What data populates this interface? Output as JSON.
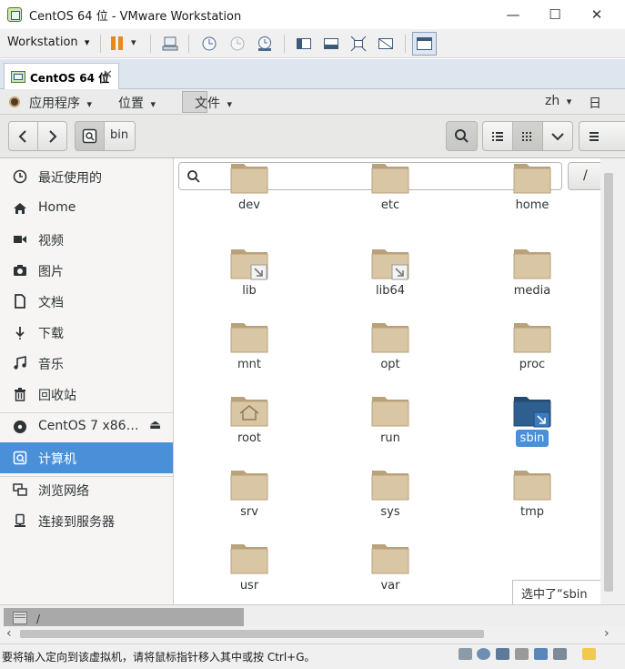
{
  "window": {
    "title": "CentOS 64 位 - VMware Workstation",
    "minimize": "—",
    "maximize": "☐",
    "close": "✕"
  },
  "vmware_toolbar": {
    "menu_label": "Workstation",
    "menu_arrow": "▾",
    "pause_arrow": "▾"
  },
  "tabs": [
    {
      "label": "CentOS 64 位",
      "close": "✕"
    }
  ],
  "gnome_topbar": {
    "applications": "应用程序",
    "places": "位置",
    "files": "文件",
    "language": "zh",
    "clock_partial": "日",
    "menu_arrow": "▾"
  },
  "header": {
    "back_icon": "chevron-left-icon",
    "forward_icon": "chevron-right-icon",
    "path": "bin",
    "search_icon": "search-icon",
    "list_view_icon": "list-icon",
    "grid_view_icon": "grid-icon",
    "view_options_icon": "chevron-down-icon",
    "menu_icon": "hamburger-icon"
  },
  "sidebar": {
    "places": [
      {
        "label": "最近使用的",
        "icon": "clock-icon"
      },
      {
        "label": "Home",
        "icon": "home-icon"
      },
      {
        "label": "视频",
        "icon": "video-icon"
      },
      {
        "label": "图片",
        "icon": "camera-icon"
      },
      {
        "label": "文档",
        "icon": "document-icon"
      },
      {
        "label": "下载",
        "icon": "download-icon"
      },
      {
        "label": "音乐",
        "icon": "music-icon"
      },
      {
        "label": "回收站",
        "icon": "trash-icon"
      }
    ],
    "devices": [
      {
        "label": "CentOS 7 x86…",
        "icon": "disc-icon",
        "eject": "⏏"
      },
      {
        "label": "计算机",
        "icon": "computer-icon",
        "active": true
      }
    ],
    "network": [
      {
        "label": "浏览网络",
        "icon": "network-icon"
      },
      {
        "label": "连接到服务器",
        "icon": "server-icon"
      }
    ]
  },
  "content": {
    "search_placeholder": "",
    "path_root": "/",
    "status_popup": "选中了“sbin",
    "files": [
      {
        "name": "dev",
        "type": "folder"
      },
      {
        "name": "etc",
        "type": "folder"
      },
      {
        "name": "home",
        "type": "folder"
      },
      {
        "name": "lib",
        "type": "symlink"
      },
      {
        "name": "lib64",
        "type": "symlink"
      },
      {
        "name": "media",
        "type": "folder"
      },
      {
        "name": "mnt",
        "type": "folder"
      },
      {
        "name": "opt",
        "type": "folder"
      },
      {
        "name": "proc",
        "type": "folder"
      },
      {
        "name": "root",
        "type": "home-folder"
      },
      {
        "name": "run",
        "type": "folder"
      },
      {
        "name": "sbin",
        "type": "symlink",
        "selected": true
      },
      {
        "name": "srv",
        "type": "folder"
      },
      {
        "name": "sys",
        "type": "folder"
      },
      {
        "name": "tmp",
        "type": "folder"
      },
      {
        "name": "usr",
        "type": "folder"
      },
      {
        "name": "var",
        "type": "folder"
      }
    ]
  },
  "bottom": {
    "thumbnail_label": "/",
    "scroll_left": "‹",
    "scroll_right": "›",
    "hint": "要将输入定向到该虚拟机，请将鼠标指针移入其中或按 Ctrl+G。"
  },
  "colors": {
    "selection": "#4a90d9",
    "folder": "#d9c6a5",
    "folder_selected": "#2f5f8f",
    "accent_pause": "#e88a1a"
  }
}
